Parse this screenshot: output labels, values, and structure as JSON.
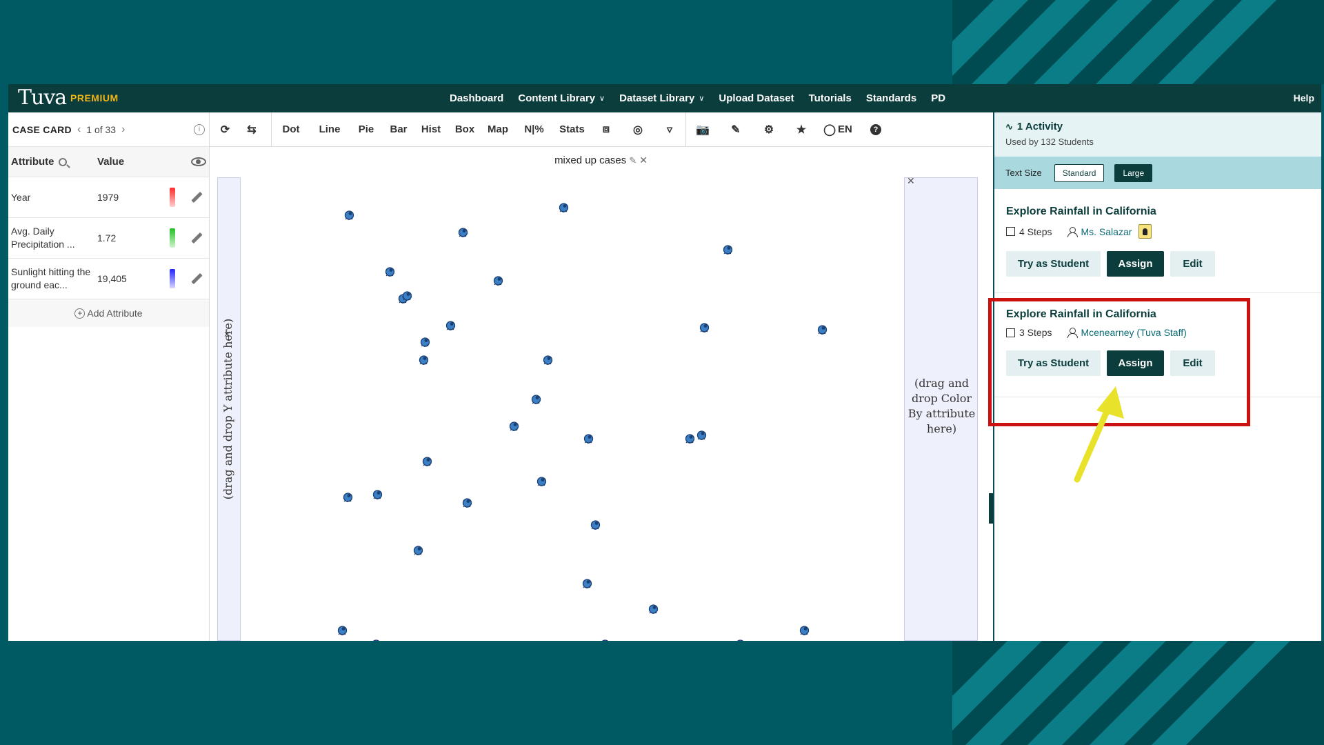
{
  "app": {
    "logo": "Tuva",
    "logo_badge": "PREMIUM",
    "nav": [
      {
        "label": "Dashboard",
        "dropdown": false
      },
      {
        "label": "Content Library",
        "dropdown": true
      },
      {
        "label": "Dataset Library",
        "dropdown": true
      },
      {
        "label": "Upload Dataset",
        "dropdown": false
      },
      {
        "label": "Tutorials",
        "dropdown": false
      },
      {
        "label": "Standards",
        "dropdown": false
      },
      {
        "label": "PD",
        "dropdown": false
      }
    ],
    "help": "Help"
  },
  "case_card": {
    "title": "CASE CARD",
    "position": "1 of 33",
    "col_attribute": "Attribute",
    "col_value": "Value",
    "rows": [
      {
        "attribute": "Year",
        "value": "1979",
        "color": "red"
      },
      {
        "attribute": "Avg. Daily Precipitation ...",
        "value": "1.72",
        "color": "green"
      },
      {
        "attribute": "Sunlight hitting the ground eac...",
        "value": "19,405",
        "color": "blue"
      }
    ],
    "add_attribute": "Add Attribute"
  },
  "toolbar": {
    "buttons": [
      "Dot",
      "Line",
      "Pie",
      "Bar",
      "Hist",
      "Box",
      "Map",
      "N|%",
      "Stats"
    ],
    "language": "EN"
  },
  "graph": {
    "title": "mixed up cases",
    "y_drop_hint": "(drag and drop Y attribute here)",
    "color_drop_hint": "(drag and drop Color By attribute here)"
  },
  "right_panel": {
    "activity_count": "1 Activity",
    "used_by": "Used by 132 Students",
    "text_size_label": "Text Size",
    "text_size_standard": "Standard",
    "text_size_large": "Large",
    "activities": [
      {
        "title": "Explore Rainfall in California",
        "steps": "4 Steps",
        "author": "Ms. Salazar",
        "try": "Try as Student",
        "assign": "Assign",
        "edit": "Edit"
      },
      {
        "title": "Explore Rainfall in California",
        "steps": "3 Steps",
        "author": "Mcenearney (Tuva Staff)",
        "try": "Try as Student",
        "assign": "Assign",
        "edit": "Edit"
      }
    ]
  },
  "colors": {
    "background": "#005a63",
    "brand_dark": "#0b3d3c",
    "highlight": "#cc1111",
    "arrow": "#e8e22a",
    "point": "#3b7fc4"
  }
}
